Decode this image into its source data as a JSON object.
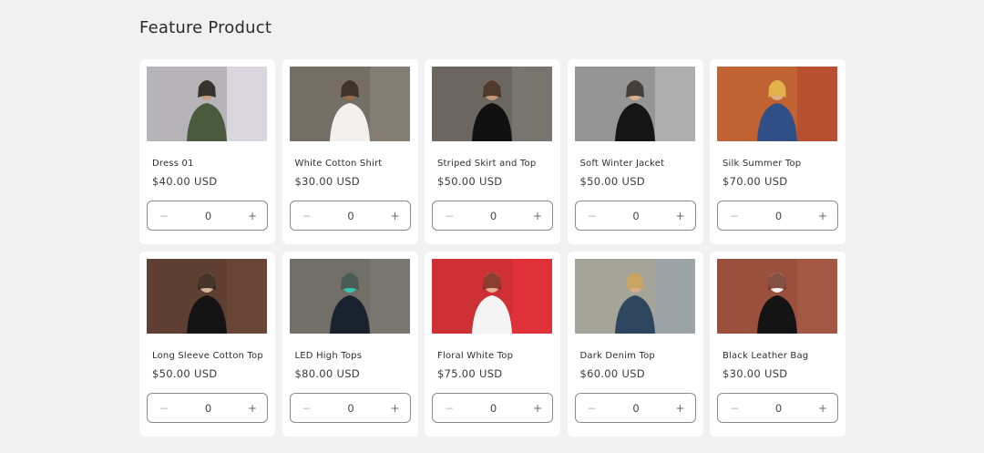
{
  "section": {
    "title": "Feature Product"
  },
  "products": [
    {
      "name": "Dress 01",
      "price": "$40.00 USD",
      "quantity": "0",
      "minus": "−",
      "plus": "+",
      "image": "woman-graffiti-wall-photo",
      "colors": {
        "bg": "#e8e4ec",
        "accent": "#4a5a3c",
        "skin": "#c9a083",
        "dark": "#1f1f1f"
      }
    },
    {
      "name": "White Cotton Shirt",
      "price": "$30.00 USD",
      "quantity": "0",
      "minus": "−",
      "plus": "+",
      "image": "woman-white-shirt-photo",
      "colors": {
        "bg": "#8b8478",
        "accent": "#f2f0ec",
        "skin": "#9a6a4c",
        "dark": "#2e2a26"
      }
    },
    {
      "name": "Striped Skirt and Top",
      "price": "$50.00 USD",
      "quantity": "0",
      "minus": "−",
      "plus": "+",
      "image": "woman-striped-skirt-photo",
      "colors": {
        "bg": "#7d7a76",
        "accent": "#111111",
        "skin": "#c99a7c",
        "dark": "#3b2a20"
      }
    },
    {
      "name": "Soft Winter Jacket",
      "price": "$50.00 USD",
      "quantity": "0",
      "minus": "−",
      "plus": "+",
      "image": "woman-winter-jacket-photo",
      "colors": {
        "bg": "#b9b9b9",
        "accent": "#151515",
        "skin": "#d8b08c",
        "dark": "#2b2b2b"
      }
    },
    {
      "name": "Silk Summer Top",
      "price": "$70.00 USD",
      "quantity": "0",
      "minus": "−",
      "plus": "+",
      "image": "woman-silk-top-photo",
      "colors": {
        "bg": "#b4472f",
        "accent": "#2f4f86",
        "skin": "#d9b08a",
        "dark": "#e2b33c"
      }
    },
    {
      "name": "Long Sleeve Cotton Top",
      "price": "$50.00 USD",
      "quantity": "0",
      "minus": "−",
      "plus": "+",
      "image": "woman-long-sleeve-photo",
      "colors": {
        "bg": "#6f4a3a",
        "accent": "#141414",
        "skin": "#d8b79a",
        "dark": "#2b1e18"
      }
    },
    {
      "name": "LED High Tops",
      "price": "$80.00 USD",
      "quantity": "0",
      "minus": "−",
      "plus": "+",
      "image": "led-sneakers-photo",
      "colors": {
        "bg": "#7e7b73",
        "accent": "#1a2230",
        "skin": "#35c6b8",
        "dark": "#4c4a44"
      }
    },
    {
      "name": "Floral White Top",
      "price": "$75.00 USD",
      "quantity": "0",
      "minus": "−",
      "plus": "+",
      "image": "woman-floral-top-photo",
      "colors": {
        "bg": "#e8323c",
        "accent": "#f4f4f4",
        "skin": "#e6b69a",
        "dark": "#7a2a20"
      }
    },
    {
      "name": "Dark Denim Top",
      "price": "$60.00 USD",
      "quantity": "0",
      "minus": "−",
      "plus": "+",
      "image": "woman-denim-jacket-photo",
      "colors": {
        "bg": "#9aa4ac",
        "accent": "#2e4660",
        "skin": "#d6ae8c",
        "dark": "#c7a35e"
      }
    },
    {
      "name": "Black Leather Bag",
      "price": "$30.00 USD",
      "quantity": "0",
      "minus": "−",
      "plus": "+",
      "image": "leather-bag-brick-wall-photo",
      "colors": {
        "bg": "#a85a45",
        "accent": "#141414",
        "skin": "#f2f2f2",
        "dark": "#6e3526"
      }
    }
  ]
}
